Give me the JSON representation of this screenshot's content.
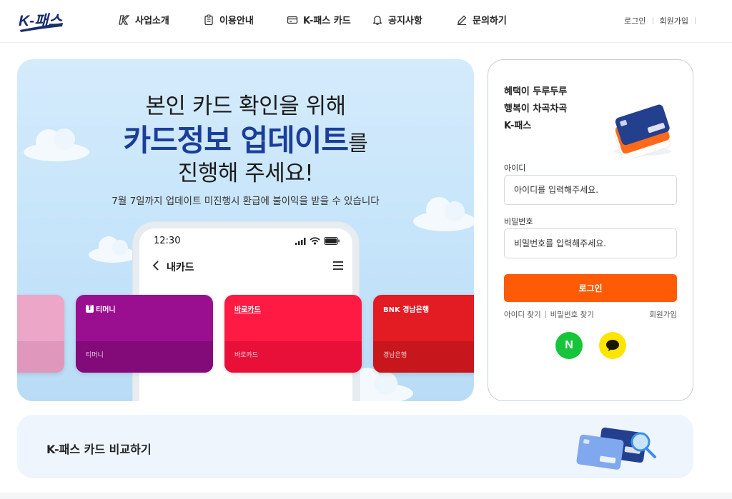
{
  "header": {
    "logo_text": "K-패스",
    "nav": [
      {
        "label": "사업소개",
        "icon": "k-logo-icon"
      },
      {
        "label": "이용안내",
        "icon": "clipboard-icon"
      },
      {
        "label": "K-패스 카드",
        "icon": "card-icon"
      },
      {
        "label": "공지사항",
        "icon": "bell-icon"
      },
      {
        "label": "문의하기",
        "icon": "pencil-icon"
      }
    ],
    "login_link": "로그인",
    "signup_link": "회원가입"
  },
  "banner": {
    "line1": "본인 카드 확인을 위해",
    "line2_highlight": "카드정보 업데이트",
    "line2_suffix": "를",
    "line3": "진행해 주세요!",
    "subtext": "7월 7일까지 업데이트 미진행시 환급에 불이익을 받을 수 있습니다",
    "phone": {
      "time": "12:30",
      "title": "내카드"
    },
    "cards": [
      {
        "brand": "",
        "name": "",
        "color": "#eba6c8",
        "bottom": "#df98bc"
      },
      {
        "brand": "티머니",
        "name": "티머니",
        "color": "#9a0f8f",
        "bottom": "#830a79",
        "logo_mark": "T"
      },
      {
        "brand": "바로카드",
        "name": "바로카드",
        "color": "#ff1a43",
        "bottom": "#e81039"
      },
      {
        "brand": "BNK 경남은행",
        "name": "경남은행",
        "color": "#e31b23",
        "bottom": "#c8161d"
      }
    ]
  },
  "login": {
    "slogan": [
      "혜택이 두루두루",
      "행복이 차곡차곡",
      "K-패스"
    ],
    "id_label": "아이디",
    "id_placeholder": "아이디를 입력해주세요.",
    "pw_label": "비밀번호",
    "pw_placeholder": "비밀번호를 입력해주세요.",
    "button": "로그인",
    "find_id": "아이디 찾기",
    "find_pw": "비밀번호 찾기",
    "join": "회원가입",
    "naver_letter": "N",
    "colors": {
      "accent": "#ff5a05",
      "naver": "#16c53a",
      "kakao": "#fee500"
    }
  },
  "compare": {
    "title": "K-패스 카드 비교하기"
  },
  "colors": {
    "brand_navy": "#1a3e99"
  }
}
